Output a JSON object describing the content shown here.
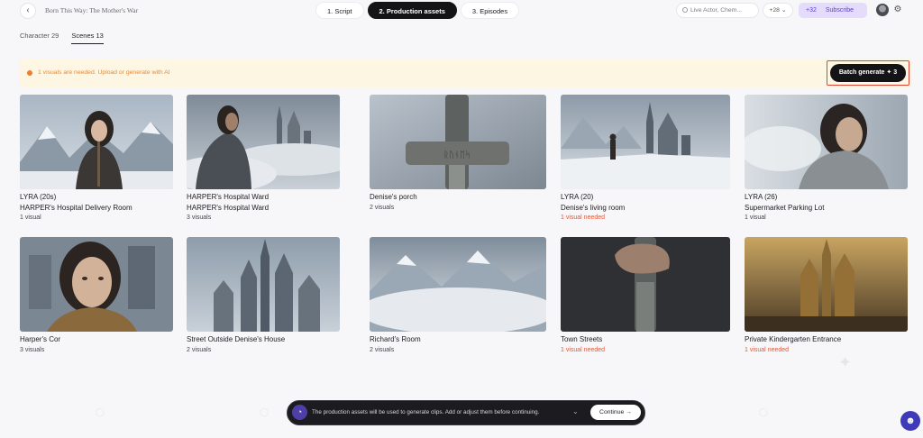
{
  "header": {
    "project_title": "Born This Way: The Mother's War",
    "steps": [
      {
        "label": "1. Script"
      },
      {
        "label": "2. Production assets"
      },
      {
        "label": "3. Episodes"
      }
    ],
    "model_select": "Live Actor, Chem...",
    "credits": "+28",
    "plan_credits": "+32",
    "subscribe_label": "Subscribe"
  },
  "tabs": [
    {
      "label": "Character 29"
    },
    {
      "label": "Scenes 13"
    }
  ],
  "notice": {
    "text": "1 visuals are needed. Upload or generate with AI",
    "batch_label": "Batch generate ✦ 3"
  },
  "scenes": [
    {
      "title": "LYRA (20s)",
      "subtitle": "HARPER's Hospital Delivery Room",
      "count": "1 visual",
      "needed": false,
      "icon": "girl-sword-mountain"
    },
    {
      "title": "HARPER's Hospital Ward",
      "subtitle": "HARPER's Hospital Ward",
      "count": "3 visuals",
      "needed": false,
      "icon": "woman-castle-clouds"
    },
    {
      "title": "Denise's porch",
      "count": "2 visuals",
      "needed": false,
      "icon": "runic-sword-hilt"
    },
    {
      "title": "LYRA (20)",
      "subtitle": "Denise's living room",
      "count": "1 visual needed",
      "needed": true,
      "icon": "figure-snow-castle"
    },
    {
      "title": "LYRA (26)",
      "subtitle": "Supermarket Parking Lot",
      "count": "1 visual",
      "needed": false,
      "icon": "woman-blizzard"
    },
    {
      "title": "Harper's Cor",
      "count": "3 visuals",
      "needed": false,
      "icon": "girl-portrait"
    },
    {
      "title": "Street Outside Denise's House",
      "count": "2 visuals",
      "needed": false,
      "icon": "gothic-castle"
    },
    {
      "title": "Richard's Room",
      "count": "2 visuals",
      "needed": false,
      "icon": "snowy-peaks"
    },
    {
      "title": "Town Streets",
      "count": "1 visual needed",
      "needed": true,
      "icon": "hand-sword-hilt"
    },
    {
      "title": "Private Kindergarten Entrance",
      "count": "1 visual needed",
      "needed": true,
      "icon": "golden-castle"
    }
  ],
  "bottom_bar": {
    "text": "The production assets will be used to generate clips. Add or adjust them before continuing.",
    "continue_label": "Continue →"
  },
  "colors": {
    "accent": "#141417",
    "needed": "#e05a3c",
    "notice_bg": "#fdf6e2",
    "subscribe_bg": "#e5dcfb"
  }
}
